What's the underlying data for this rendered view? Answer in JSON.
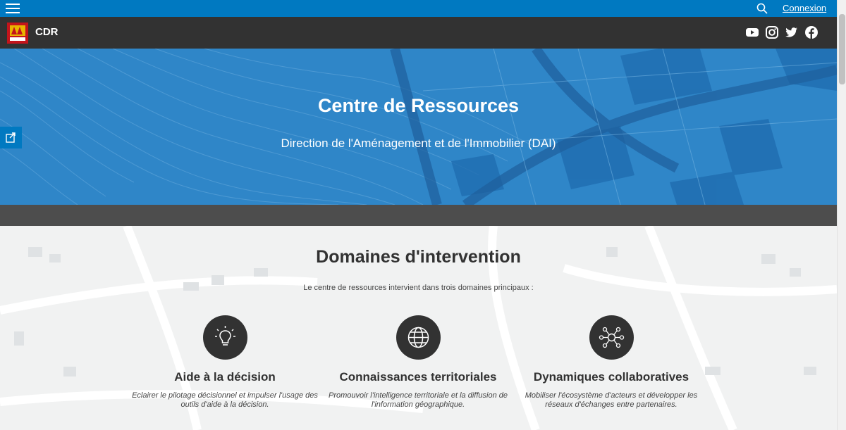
{
  "topbar": {
    "menu_icon": "hamburger-icon",
    "search_icon": "search-icon",
    "login_label": "Connexion"
  },
  "header": {
    "site_title": "CDR",
    "logo_icon": "region-logo",
    "social": [
      "youtube-icon",
      "instagram-icon",
      "twitter-icon",
      "facebook-icon"
    ]
  },
  "hero": {
    "title": "Centre de Ressources",
    "subtitle": "Direction de l'Aménagement et de l'Immobilier (DAI)",
    "share_icon": "share-icon"
  },
  "domains": {
    "title": "Domaines d'intervention",
    "intro": "Le centre de ressources intervient dans trois domaines principaux :",
    "cards": [
      {
        "icon": "lightbulb-icon",
        "title": "Aide à la décision",
        "desc": "Eclairer le pilotage décisionnel et impulser l'usage des outils d'aide à la décision."
      },
      {
        "icon": "globe-icon",
        "title": "Connaissances territoriales",
        "desc": "Promouvoir l'intelligence territoriale et la diffusion de l'information géographique."
      },
      {
        "icon": "network-icon",
        "title": "Dynamiques collaboratives",
        "desc": "Mobiliser l'écosystème d'acteurs et développer les réseaux d'échanges entre partenaires."
      }
    ]
  },
  "colors": {
    "brand_blue": "#0079c1",
    "header_dark": "#323232",
    "logo_red": "#c3141b"
  }
}
